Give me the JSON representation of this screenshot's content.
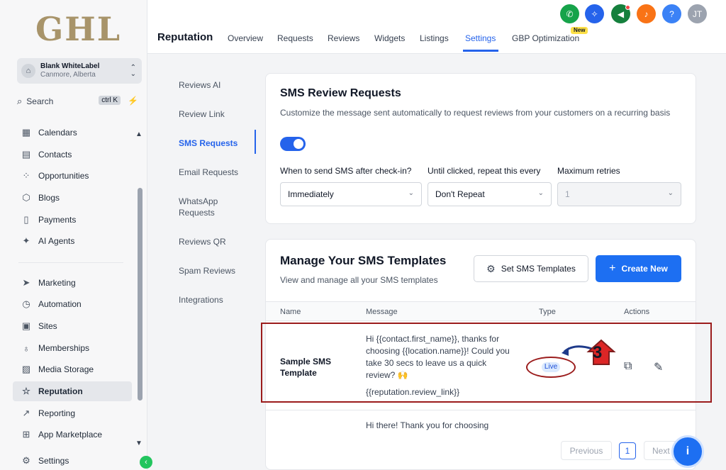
{
  "sidebar": {
    "logo": "GHL",
    "account": {
      "name": "Blank WhiteLabel",
      "location": "Canmore, Alberta"
    },
    "search": {
      "label": "Search",
      "shortcut": "ctrl K"
    },
    "items": [
      {
        "label": "Calendars",
        "icon": "calendar-icon"
      },
      {
        "label": "Contacts",
        "icon": "contacts-icon"
      },
      {
        "label": "Opportunities",
        "icon": "opportunities-icon"
      },
      {
        "label": "Blogs",
        "icon": "blogs-icon"
      },
      {
        "label": "Payments",
        "icon": "payments-icon"
      },
      {
        "label": "AI Agents",
        "icon": "ai-agents-icon"
      },
      {
        "label": "Marketing",
        "icon": "marketing-icon"
      },
      {
        "label": "Automation",
        "icon": "automation-icon"
      },
      {
        "label": "Sites",
        "icon": "sites-icon"
      },
      {
        "label": "Memberships",
        "icon": "memberships-icon"
      },
      {
        "label": "Media Storage",
        "icon": "media-icon"
      },
      {
        "label": "Reputation",
        "icon": "star-icon"
      },
      {
        "label": "Reporting",
        "icon": "reporting-icon"
      },
      {
        "label": "App Marketplace",
        "icon": "marketplace-icon"
      },
      {
        "label": "Settings",
        "icon": "gear-icon"
      }
    ]
  },
  "header": {
    "title": "Reputation",
    "tabs": [
      "Overview",
      "Requests",
      "Reviews",
      "Widgets",
      "Listings",
      "Settings",
      "GBP Optimization"
    ],
    "active_tab": "Settings",
    "new_badge": "New",
    "user_initials": "JT",
    "colors": {
      "phone": "#16a34a",
      "tools": "#2563eb",
      "announce": "#15803d",
      "bell": "#f97316",
      "help": "#3b82f6",
      "avatar": "#9ca3af"
    }
  },
  "settings_nav": {
    "items": [
      "Reviews AI",
      "Review Link",
      "SMS Requests",
      "Email Requests",
      "WhatsApp Requests",
      "Reviews QR",
      "Spam Reviews",
      "Integrations"
    ],
    "active": "SMS Requests"
  },
  "sms_requests": {
    "title": "SMS Review Requests",
    "description": "Customize the message sent automatically to request reviews from your customers on a recurring basis",
    "enabled": true,
    "fields": [
      {
        "label": "When to send SMS after check-in?",
        "value": "Immediately"
      },
      {
        "label": "Until clicked, repeat this every",
        "value": "Don't Repeat"
      },
      {
        "label": "Maximum retries",
        "value": "1"
      }
    ]
  },
  "templates": {
    "title": "Manage Your SMS Templates",
    "subtitle": "View and manage all your SMS templates",
    "set_button": "Set SMS Templates",
    "create_button": "Create New",
    "columns": [
      "Name",
      "Message",
      "Type",
      "Actions"
    ],
    "rows": [
      {
        "name_line1": "Sample SMS",
        "name_line2": "Template",
        "message": "Hi {{contact.first_name}}, thanks for choosing {{location.name}}! Could you take 30 secs to leave us a quick review? 🙌",
        "link": "{{reputation.review_link}}",
        "type": "Live"
      },
      {
        "message": "Hi there! Thank you for choosing"
      }
    ],
    "pagination": {
      "previous": "Previous",
      "current": "1",
      "next": "Next"
    }
  },
  "annotation": {
    "step": "3"
  }
}
